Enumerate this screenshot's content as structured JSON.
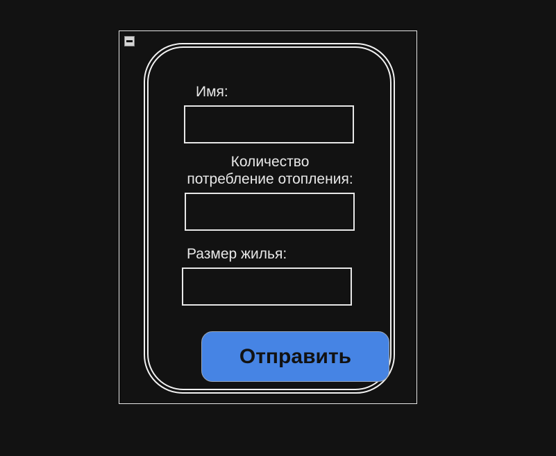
{
  "form": {
    "name_label": "Имя:",
    "name_value": "",
    "heating_label_line1": "Количество",
    "heating_label_line2": "потребление отопления:",
    "heating_value": "",
    "size_label": "Размер жилья:",
    "size_value": "",
    "submit_label": "Отправить"
  },
  "colors": {
    "background": "#121212",
    "border": "#e8e8e8",
    "submit_bg": "#4684e4",
    "submit_text": "#121212"
  }
}
